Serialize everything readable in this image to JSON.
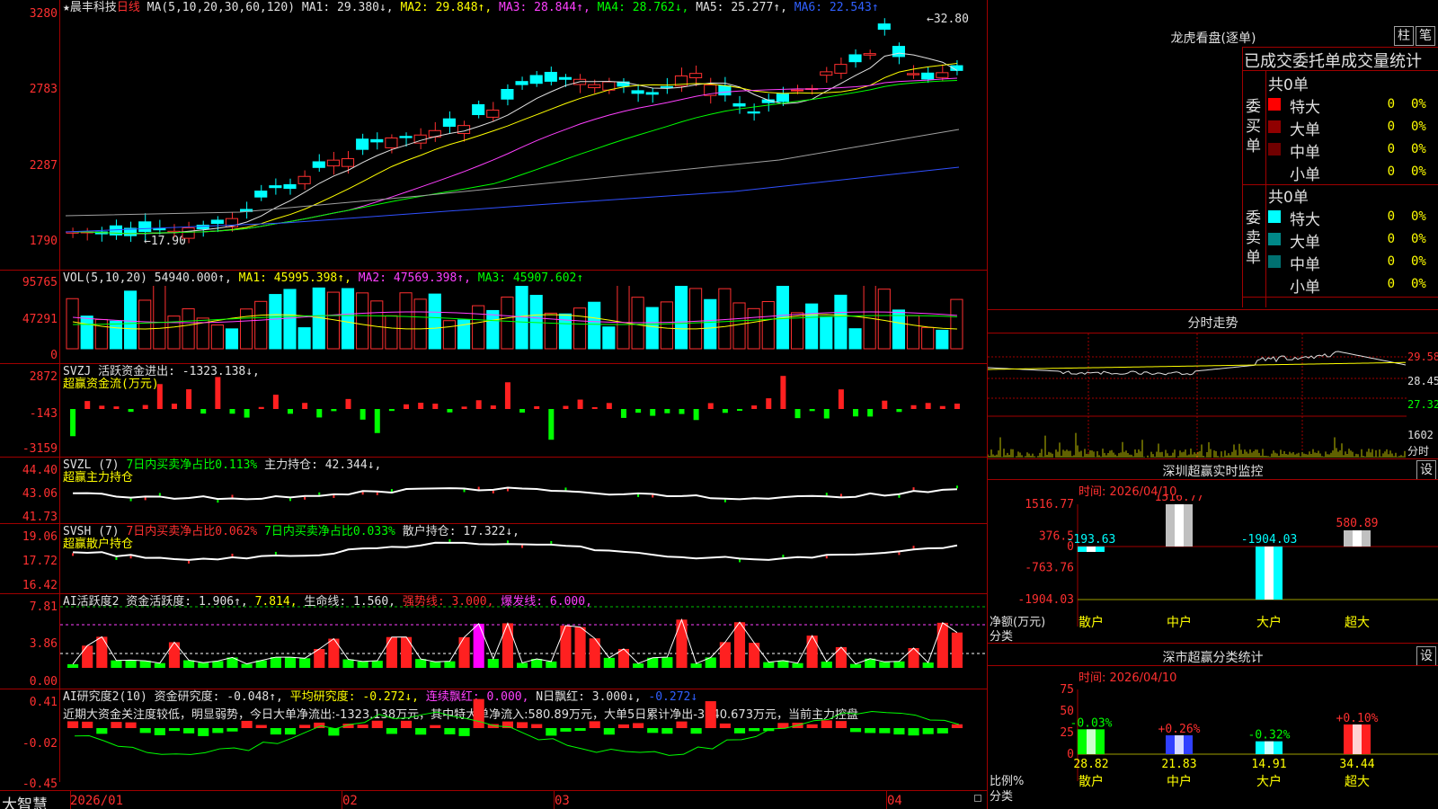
{
  "main": {
    "star_title": "★晨丰科技",
    "period": "日线",
    "ma_spec": "MA(5,10,20,30,60,120)",
    "ma1": "MA1: 29.380↓,",
    "ma2": "MA2: 29.848↑,",
    "ma3": "MA3: 28.844↑,",
    "ma4": "MA4: 28.762↓,",
    "ma5": "MA5: 25.277↑,",
    "ma6": "MA6: 22.543↑",
    "y_labels": [
      "3280",
      "2783",
      "2287",
      "1790"
    ],
    "high_label": "32.80",
    "low_label": "←17.90"
  },
  "vol": {
    "spec": "VOL(5,10,20)",
    "value": "54940.000↑,",
    "ma1": "MA1: 45995.398↑,",
    "ma2": "MA2: 47569.398↑,",
    "ma3": "MA3: 45907.602↑",
    "y_labels": [
      "95765",
      "47291",
      "0"
    ]
  },
  "svzj": {
    "line1": "SVZJ  活跃资金进出: -1323.138↓,",
    "line2": "超赢资金流(万元)",
    "y_labels": [
      "2872",
      "-143",
      "-3159"
    ]
  },
  "svzl": {
    "name": "SVZL (7)",
    "ratio": "7日内买卖净占比0.113%",
    "hold": "主力持仓: 42.344↓,",
    "line2": "超赢主力持仓",
    "y_labels": [
      "44.40",
      "43.06",
      "41.73"
    ]
  },
  "svsh": {
    "name": "SVSH (7)",
    "ratio1": "7日内买卖净占比0.062%",
    "ratio2": "7日内买卖净占比0.033%",
    "hold": "散户持仓: 17.322↓,",
    "line2": "超赢散户持仓",
    "y_labels": [
      "19.06",
      "17.72",
      "16.42"
    ]
  },
  "ai": {
    "line": "AI活跃度2 资金活跃度: 1.906↑,",
    "v2": "7.814,",
    "life": "生命线: 1.560,",
    "strong": "强势线: 3.000,",
    "burst": "爆发线: 6.000,",
    "y_labels": [
      "7.81",
      "3.86",
      "0.00"
    ]
  },
  "research": {
    "line": "AI研究度2(10) 资金研究度: -0.048↑,",
    "avg": "平均研究度: -0.272↓,",
    "cont": "连续飘红: 0.000,",
    "nday": "N日飘红: 3.000↓,",
    "last": "-0.272↓",
    "comment": "近期大资金关注度较低，明显弱势，今日大单净流出:-1323.138万元，其中特大单净流入:580.89万元，大单5日累计净出-3240.673万元，当前主力控盘",
    "y_labels": [
      "0.41",
      "-0.02",
      "-0.45"
    ]
  },
  "bottom": {
    "logo": "大智慧",
    "dates": [
      "2026/01",
      "02",
      "03",
      "04"
    ]
  },
  "dragon": {
    "title": "龙虎看盘(逐单)",
    "btn1": "柱",
    "btn2": "笔",
    "tabs": "已成交委托单成交量统计",
    "buy": {
      "side_label": "委买单",
      "total": "共0单",
      "rows": [
        {
          "label": "特大",
          "value": "0",
          "pct": "0%",
          "color": "#ff0000"
        },
        {
          "label": "大单",
          "value": "0",
          "pct": "0%",
          "color": "#900000"
        },
        {
          "label": "中单",
          "value": "0",
          "pct": "0%",
          "color": "#700000"
        },
        {
          "label": "小单",
          "value": "0",
          "pct": "0%",
          "color": "#000000"
        }
      ]
    },
    "sell": {
      "side_label": "委卖单",
      "total": "共0单",
      "rows": [
        {
          "label": "特大",
          "value": "0",
          "pct": "0%",
          "color": "#00ffff"
        },
        {
          "label": "大单",
          "value": "0",
          "pct": "0%",
          "color": "#008888"
        },
        {
          "label": "中单",
          "value": "0",
          "pct": "0%",
          "color": "#007070"
        },
        {
          "label": "小单",
          "value": "0",
          "pct": "0%",
          "color": "#000000"
        }
      ]
    }
  },
  "minute": {
    "title": "分时走势",
    "y_labels": [
      "29.58",
      "28.45",
      "27.32"
    ],
    "vol_label": "1602",
    "vol_unit": "分时"
  },
  "monitor": {
    "title": "深圳超赢实时监控",
    "set": "设",
    "time": "时间: 2026/04/10",
    "y_labels": [
      "1516.77",
      "376.5",
      "0",
      "-763.76",
      "-1904.03"
    ],
    "axis_label": "净额(万元)",
    "cat_label": "分类",
    "categories": [
      "散户",
      "中户",
      "大户",
      "超大"
    ],
    "values": [
      -193.63,
      1516.77,
      -1904.03,
      580.89
    ],
    "value_labels": [
      "-193.63",
      "1516.77",
      "-1904.03",
      "580.89"
    ]
  },
  "classify": {
    "title": "深市超赢分类统计",
    "set": "设",
    "time": "时间: 2026/04/10",
    "y_labels": [
      "75",
      "50",
      "25",
      "0"
    ],
    "axis_label": "比例%",
    "cat_label": "分类",
    "categories": [
      "散户",
      "中户",
      "大户",
      "超大"
    ],
    "values": [
      28.82,
      21.83,
      14.91,
      34.44
    ],
    "value_labels": [
      "28.82",
      "21.83",
      "14.91",
      "34.44"
    ],
    "changes": [
      "-0.03%",
      "+0.26%",
      "-0.32%",
      "+0.10%"
    ]
  },
  "chart_data": [
    {
      "type": "bar",
      "title": "深圳超赢实时监控",
      "ylabel": "净额(万元)",
      "categories": [
        "散户",
        "中户",
        "大户",
        "超大"
      ],
      "values": [
        -193.63,
        1516.77,
        -1904.03,
        580.89
      ],
      "ylim": [
        -1904.03,
        1516.77
      ]
    },
    {
      "type": "bar",
      "title": "深市超赢分类统计",
      "ylabel": "比例%",
      "categories": [
        "散户",
        "中户",
        "大户",
        "超大"
      ],
      "values": [
        28.82,
        21.83,
        14.91,
        34.44
      ],
      "ylim": [
        0,
        75
      ]
    }
  ]
}
